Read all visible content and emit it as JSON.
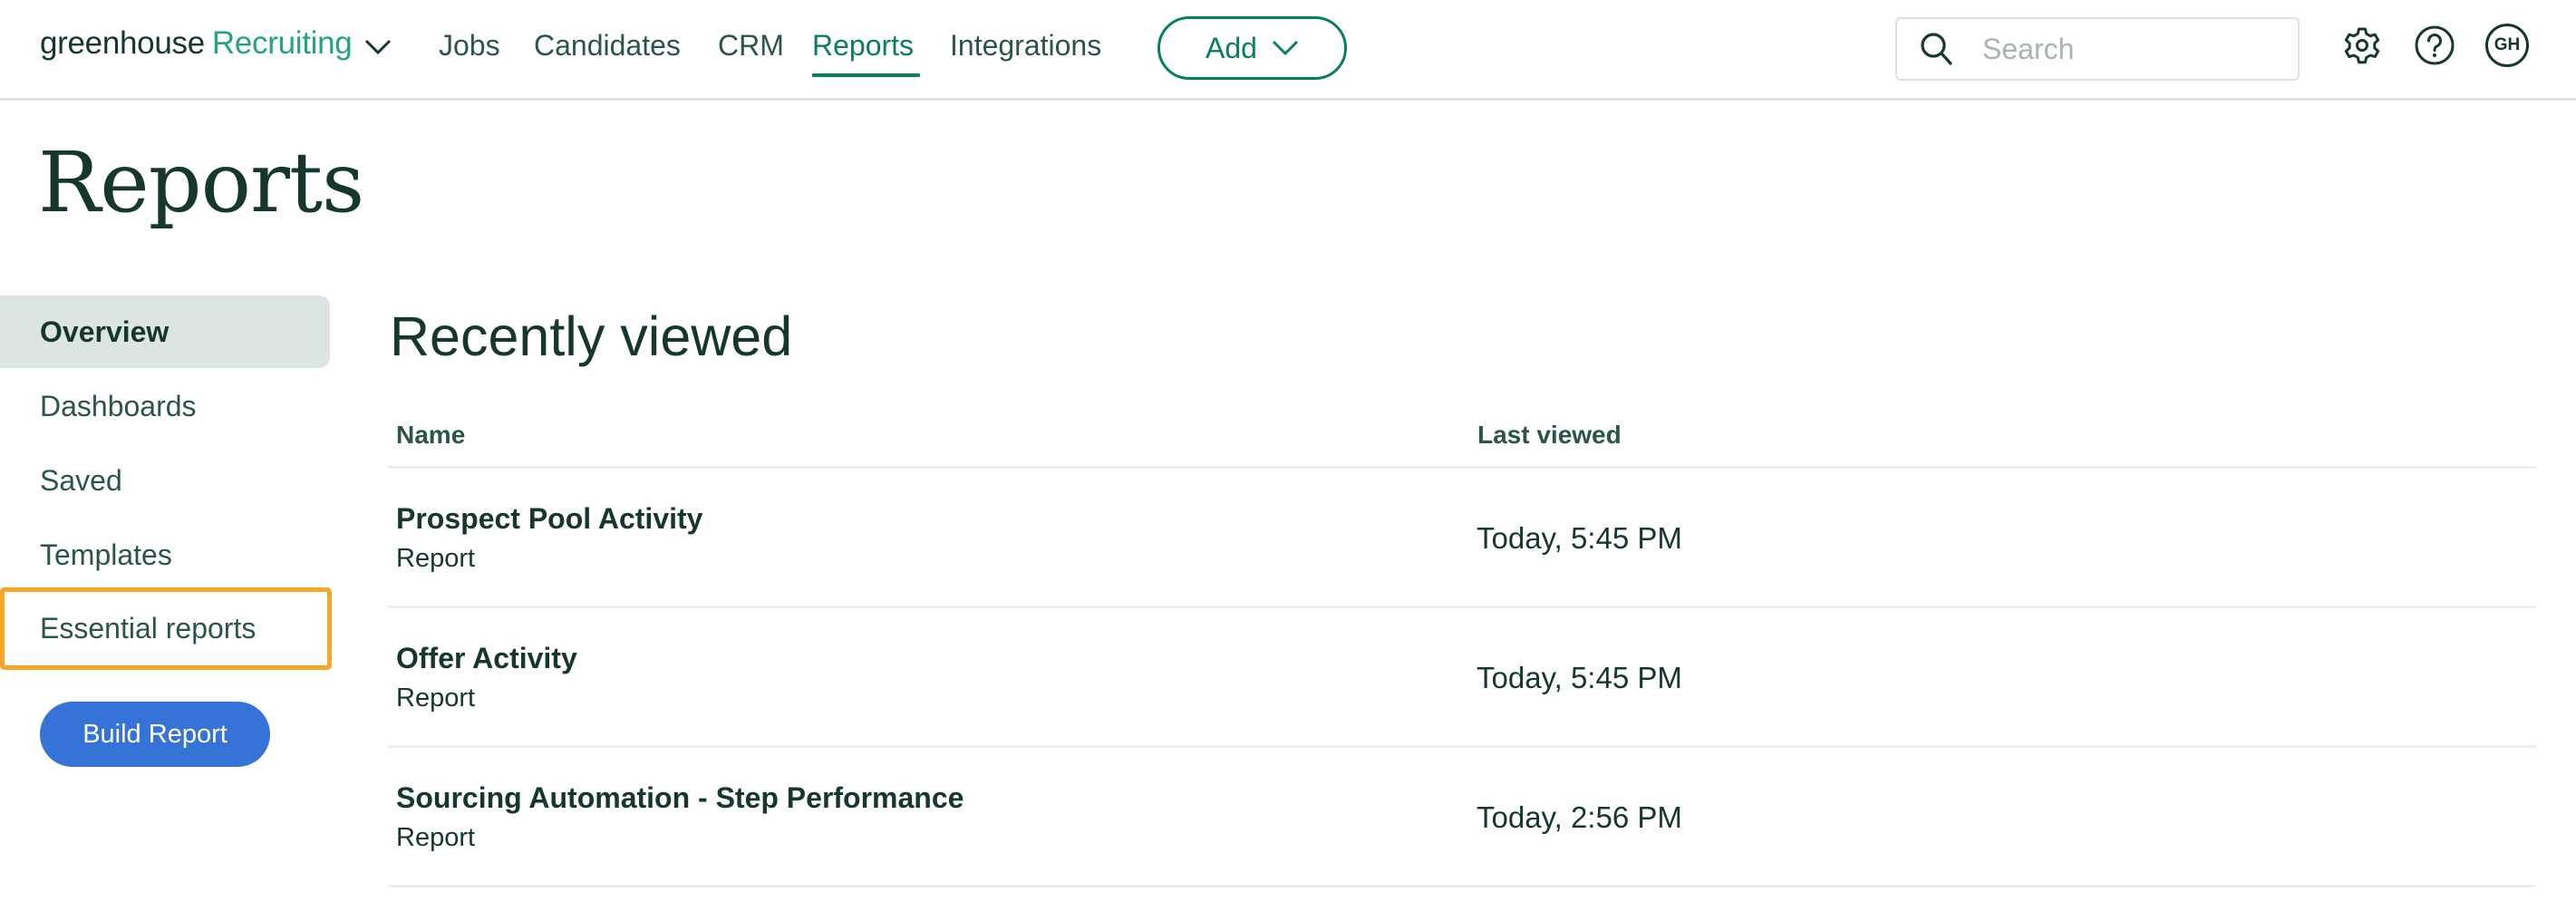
{
  "header": {
    "logo_brand": "greenhouse",
    "logo_product": "Recruiting",
    "nav": [
      {
        "label": "Jobs",
        "active": false
      },
      {
        "label": "Candidates",
        "active": false
      },
      {
        "label": "CRM",
        "active": false
      },
      {
        "label": "Reports",
        "active": true
      },
      {
        "label": "Integrations",
        "active": false
      }
    ],
    "add_label": "Add",
    "search_placeholder": "Search",
    "avatar_initials": "GH",
    "icons": [
      "chevron-down-icon",
      "search-icon",
      "gear-icon",
      "help-icon"
    ]
  },
  "page": {
    "title": "Reports"
  },
  "sidebar": {
    "items": [
      {
        "label": "Overview",
        "active": true
      },
      {
        "label": "Dashboards",
        "active": false
      },
      {
        "label": "Saved",
        "active": false
      },
      {
        "label": "Templates",
        "active": false
      },
      {
        "label": "Essential reports",
        "active": false,
        "highlighted": true
      }
    ],
    "build_button": "Build Report"
  },
  "main": {
    "section_title": "Recently viewed",
    "columns": [
      "Name",
      "Last viewed"
    ],
    "rows": [
      {
        "name": "Prospect Pool Activity",
        "type": "Report",
        "last_viewed": "Today, 5:45 PM"
      },
      {
        "name": "Offer Activity",
        "type": "Report",
        "last_viewed": "Today, 5:45 PM"
      },
      {
        "name": "Sourcing Automation - Step Performance",
        "type": "Report",
        "last_viewed": "Today, 2:56 PM"
      }
    ]
  },
  "colors": {
    "brand_dark": "#15372c",
    "brand_green": "#0a7f5c",
    "logo_green": "#24a47f",
    "primary_blue": "#3574d6",
    "highlight_orange": "#f9a52a",
    "active_bg": "#dde5e2"
  }
}
